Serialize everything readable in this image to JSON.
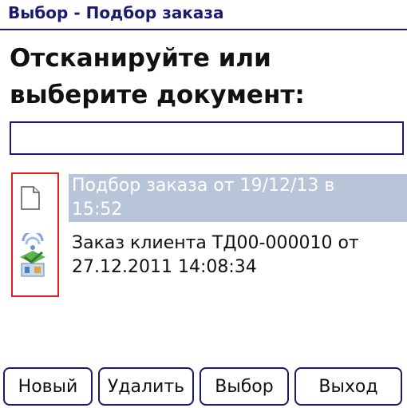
{
  "window": {
    "title": "Выбор - Подбор заказа"
  },
  "prompt": {
    "line1": "Отсканируйте или",
    "line2": "выберите документ:"
  },
  "scan": {
    "value": "",
    "placeholder": ""
  },
  "documents": [
    {
      "text_line1": "Подбор заказа от 19/12/13 в",
      "text_line2": "15:52",
      "icon": "document-icon",
      "selected": true
    },
    {
      "text_line1": "Заказ клиента ТД00-000010 от",
      "text_line2": "27.12.2011 14:08:34",
      "icon": "synced-order-icon",
      "selected": false
    }
  ],
  "buttons": {
    "new": "Новый",
    "delete": "Удалить",
    "select": "Выбор",
    "exit": "Выход"
  },
  "colors": {
    "title": "#1a1a6e",
    "selection_bg": "#b8c4d8",
    "highlight_border": "#e01e1e"
  }
}
